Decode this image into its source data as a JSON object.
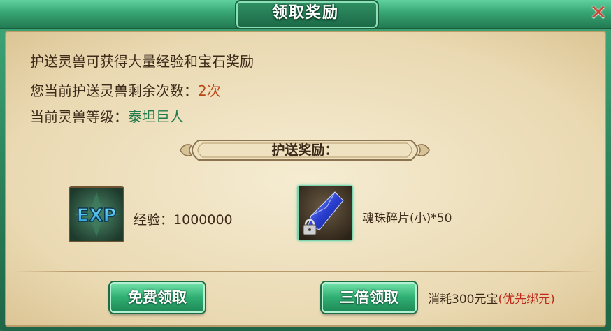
{
  "dialog": {
    "title": "领取奖励",
    "close_glyph": "✕"
  },
  "info": {
    "line1": "护送灵兽可获得大量经验和宝石奖励",
    "line2_label": "您当前护送灵兽剩余次数：",
    "line2_value": "2次",
    "line3_label": "当前灵兽等级：",
    "line3_value": "泰坦巨人"
  },
  "rewards": {
    "header": "护送奖励：",
    "exp": {
      "icon_text": "EXP",
      "label": "经验：",
      "value": "1000000"
    },
    "item": {
      "label": "魂珠碎片(小)*50"
    }
  },
  "actions": {
    "free_label": "免费领取",
    "triple_label": "三倍领取",
    "cost_label": "消耗300元宝",
    "cost_note": "(优先绑元)"
  },
  "colors": {
    "accent_green": "#2fae72",
    "highlight_orange": "#b94517",
    "highlight_green": "#1f7b4d",
    "note_red": "#c0291b"
  }
}
